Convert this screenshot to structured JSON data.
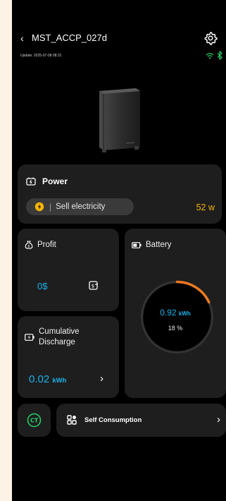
{
  "header": {
    "back_icon": "‹",
    "title": "MST_ACCP_027d",
    "update": "Update: 2025-07-08 08:31",
    "icons": [
      "settings-gear-icon",
      "wifi-icon",
      "bluetooth-icon"
    ]
  },
  "power": {
    "title": "Power",
    "mode_label": "Sell electricity",
    "separator": "|",
    "value": "52 w",
    "value_color": "#f7b500"
  },
  "profit": {
    "title": "Profit",
    "value": "0$"
  },
  "battery": {
    "title": "Battery",
    "energy_value": "0.92",
    "energy_unit": "kWh",
    "percent": "18 %",
    "level_fraction": 0.18
  },
  "cumulative": {
    "title": "Cumulative Discharge",
    "value": "0.02",
    "unit": "kWh",
    "arrow": "›"
  },
  "ct": {
    "label": "CT"
  },
  "mode": {
    "label": "Self Consumption",
    "arrow": "›"
  },
  "colors": {
    "accent_blue": "#1bb3ee",
    "accent_yellow": "#f7b500",
    "gauge_red": "#e5232a",
    "gauge_orange": "#f28c1e",
    "ct_green": "#27d36a"
  }
}
